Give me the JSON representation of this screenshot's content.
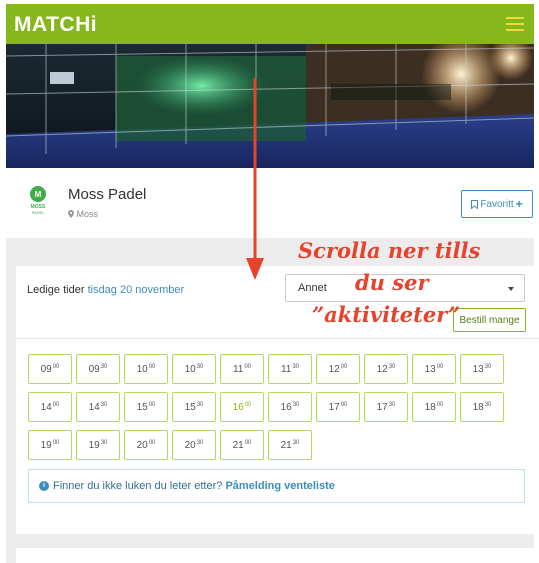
{
  "header": {
    "logo": "MATCHi",
    "menu_icon": "hamburger-icon",
    "accent_color": "#86b81b"
  },
  "club": {
    "name": "Moss Padel",
    "logo_text": "MOSS PADEL",
    "location": "Moss",
    "favorite_label": "Favoritt"
  },
  "availability": {
    "label": "Ledige tider",
    "date": "tisdag 20 november",
    "sport_select_value": "Annet",
    "book_many_label": "Bestill mange",
    "slots": [
      {
        "h": "09",
        "m": "00"
      },
      {
        "h": "09",
        "m": "30"
      },
      {
        "h": "10",
        "m": "00"
      },
      {
        "h": "10",
        "m": "30"
      },
      {
        "h": "11",
        "m": "00"
      },
      {
        "h": "11",
        "m": "30"
      },
      {
        "h": "12",
        "m": "00"
      },
      {
        "h": "12",
        "m": "30"
      },
      {
        "h": "13",
        "m": "00"
      },
      {
        "h": "13",
        "m": "30"
      },
      {
        "h": "14",
        "m": "00"
      },
      {
        "h": "14",
        "m": "30"
      },
      {
        "h": "15",
        "m": "00"
      },
      {
        "h": "15",
        "m": "30"
      },
      {
        "h": "16",
        "m": "00",
        "highlight": true
      },
      {
        "h": "16",
        "m": "30"
      },
      {
        "h": "17",
        "m": "00"
      },
      {
        "h": "17",
        "m": "30"
      },
      {
        "h": "18",
        "m": "00"
      },
      {
        "h": "18",
        "m": "30"
      },
      {
        "h": "19",
        "m": "00"
      },
      {
        "h": "19",
        "m": "30"
      },
      {
        "h": "20",
        "m": "00"
      },
      {
        "h": "20",
        "m": "30"
      },
      {
        "h": "21",
        "m": "00"
      },
      {
        "h": "21",
        "m": "30"
      }
    ],
    "info_text": "Finner du ikke luken du leter etter?",
    "info_link": "Påmelding venteliste"
  },
  "annotation": {
    "line1": "Scrolla ner tills",
    "line2": "du ser",
    "line3": "”aktiviteter”",
    "color": "#e8412c"
  }
}
